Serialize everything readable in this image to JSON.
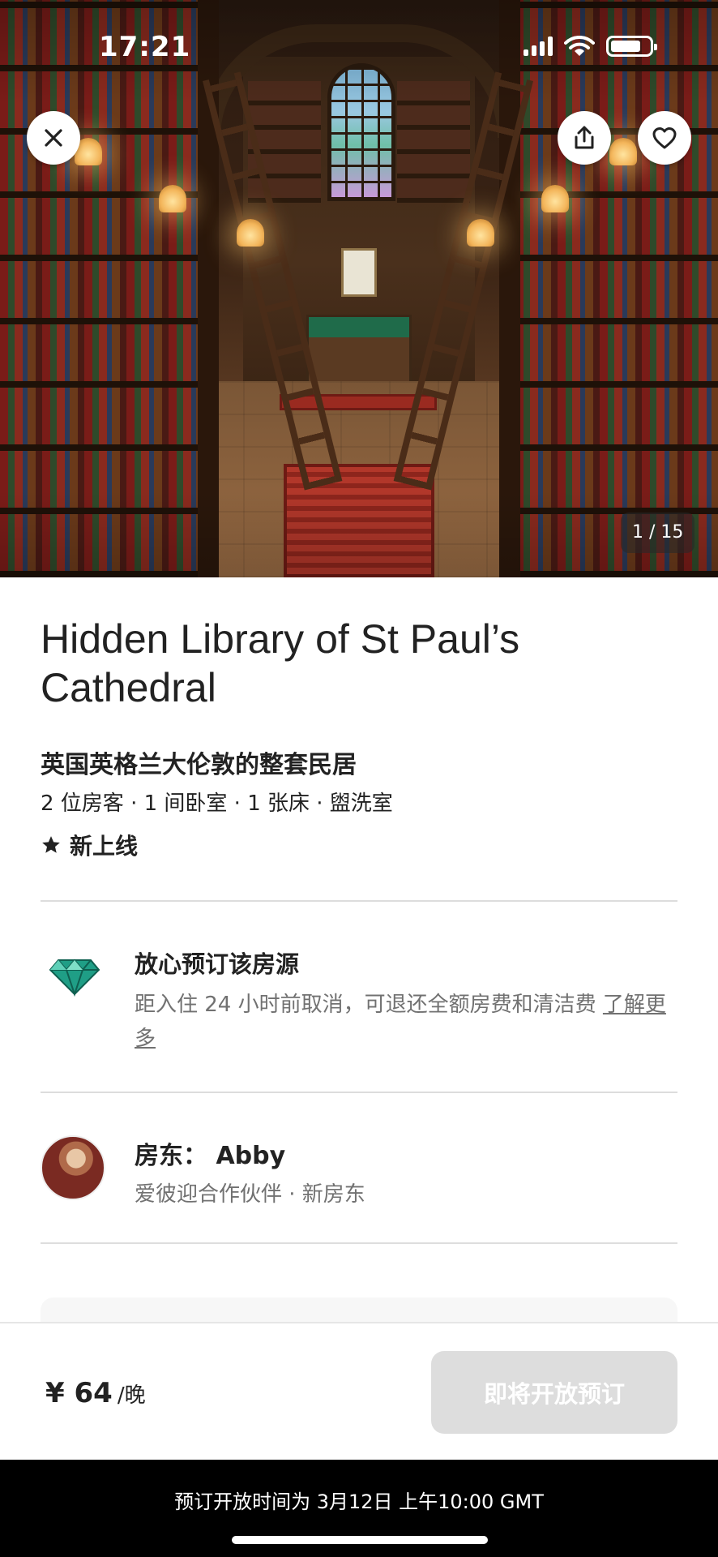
{
  "status_bar": {
    "time": "17:21"
  },
  "hero": {
    "photo_counter": "1 / 15"
  },
  "listing": {
    "title": "Hidden Library of St Paul’s Cathedral",
    "subtitle": "英国英格兰大伦敦的整套民居",
    "details": "2 位房客 · 1 间卧室 · 1 张床 · 盥洗室",
    "rating_label": "新上线"
  },
  "feature": {
    "title": "放心预订该房源",
    "description": "距入住 24 小时前取消，可退还全额房费和清洁费",
    "learn_more": "了解更多"
  },
  "host": {
    "name": "房东： Abby",
    "subtitle": "爱彼迎合作伙伴 · 新房东"
  },
  "booking": {
    "price": "¥ 64",
    "per_night": "/晚",
    "reserve_label": "即将开放预订"
  },
  "notice": {
    "text": "预订开放时间为 3月12日 上午10:00 GMT"
  },
  "colors": {
    "text_primary": "#222222",
    "text_secondary": "#717171",
    "divider": "#dddddd",
    "disabled_button": "#dddddd",
    "diamond_teal": "#1f9e86"
  },
  "icons": {
    "close": "close-icon",
    "share": "share-icon",
    "favorite": "heart-icon",
    "rating": "star-icon",
    "feature": "diamond-icon"
  }
}
